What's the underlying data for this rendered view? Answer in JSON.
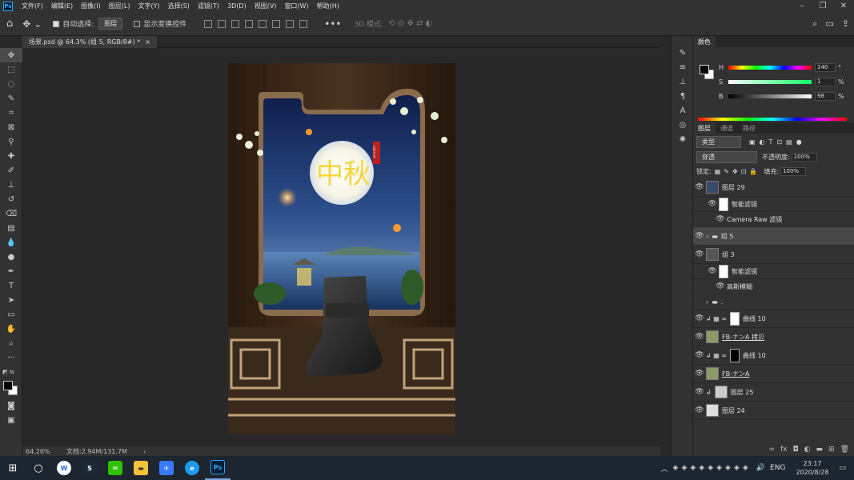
{
  "app": {
    "logo": "Ps",
    "menu": [
      "文件(F)",
      "编辑(E)",
      "图像(I)",
      "图层(L)",
      "文字(Y)",
      "选择(S)",
      "滤镜(T)",
      "3D(D)",
      "视图(V)",
      "窗口(W)",
      "帮助(H)"
    ]
  },
  "options": {
    "auto_select_label": "自动选择:",
    "auto_select_value": "图层",
    "show_transform_label": "显示变换控件",
    "mode_3d_label": "3D 模式:"
  },
  "document": {
    "tab_title": "场景.psd @ 64.3% (组 5, RGB/8#) *"
  },
  "artwork": {
    "title_chars": "中秋",
    "stamp": "八月十五"
  },
  "status": {
    "zoom": "64.26%",
    "doc_info": "文档:2.94M/131.7M"
  },
  "color_panel": {
    "tab": "颜色",
    "h_label": "H",
    "h_value": "140",
    "h_unit": "°",
    "s_label": "S",
    "s_value": "1",
    "s_unit": "%",
    "b_label": "B",
    "b_value": "98",
    "b_unit": "%"
  },
  "layers_panel": {
    "tabs": [
      "图层",
      "通道",
      "路径"
    ],
    "filter_kind": "类型",
    "blend_mode": "穿透",
    "opacity_label": "不透明度:",
    "opacity_value": "100%",
    "lock_label": "锁定:",
    "fill_label": "填充:",
    "fill_value": "100%",
    "layers": [
      {
        "name": "图层 29",
        "kind": "layer"
      },
      {
        "name": "智能滤镜",
        "kind": "sub"
      },
      {
        "name": "Camera Raw 滤镜",
        "kind": "filter"
      },
      {
        "name": "组 5",
        "kind": "group",
        "selected": true
      },
      {
        "name": "组 3",
        "kind": "layer"
      },
      {
        "name": "智能滤镜",
        "kind": "sub"
      },
      {
        "name": "高斯模糊",
        "kind": "filter"
      },
      {
        "name": ".",
        "kind": "group-hidden"
      },
      {
        "name": "曲线 10",
        "kind": "adjust"
      },
      {
        "name": "FB-ナンA 拷贝",
        "kind": "layer"
      },
      {
        "name": "曲线 10",
        "kind": "adjust-mask"
      },
      {
        "name": "FB-ナンA",
        "kind": "layer"
      },
      {
        "name": "图层 25",
        "kind": "layer"
      },
      {
        "name": "图层 24",
        "kind": "layer"
      }
    ]
  },
  "taskbar": {
    "lang": "ENG",
    "time": "23:17",
    "date": "2020/8/28"
  }
}
